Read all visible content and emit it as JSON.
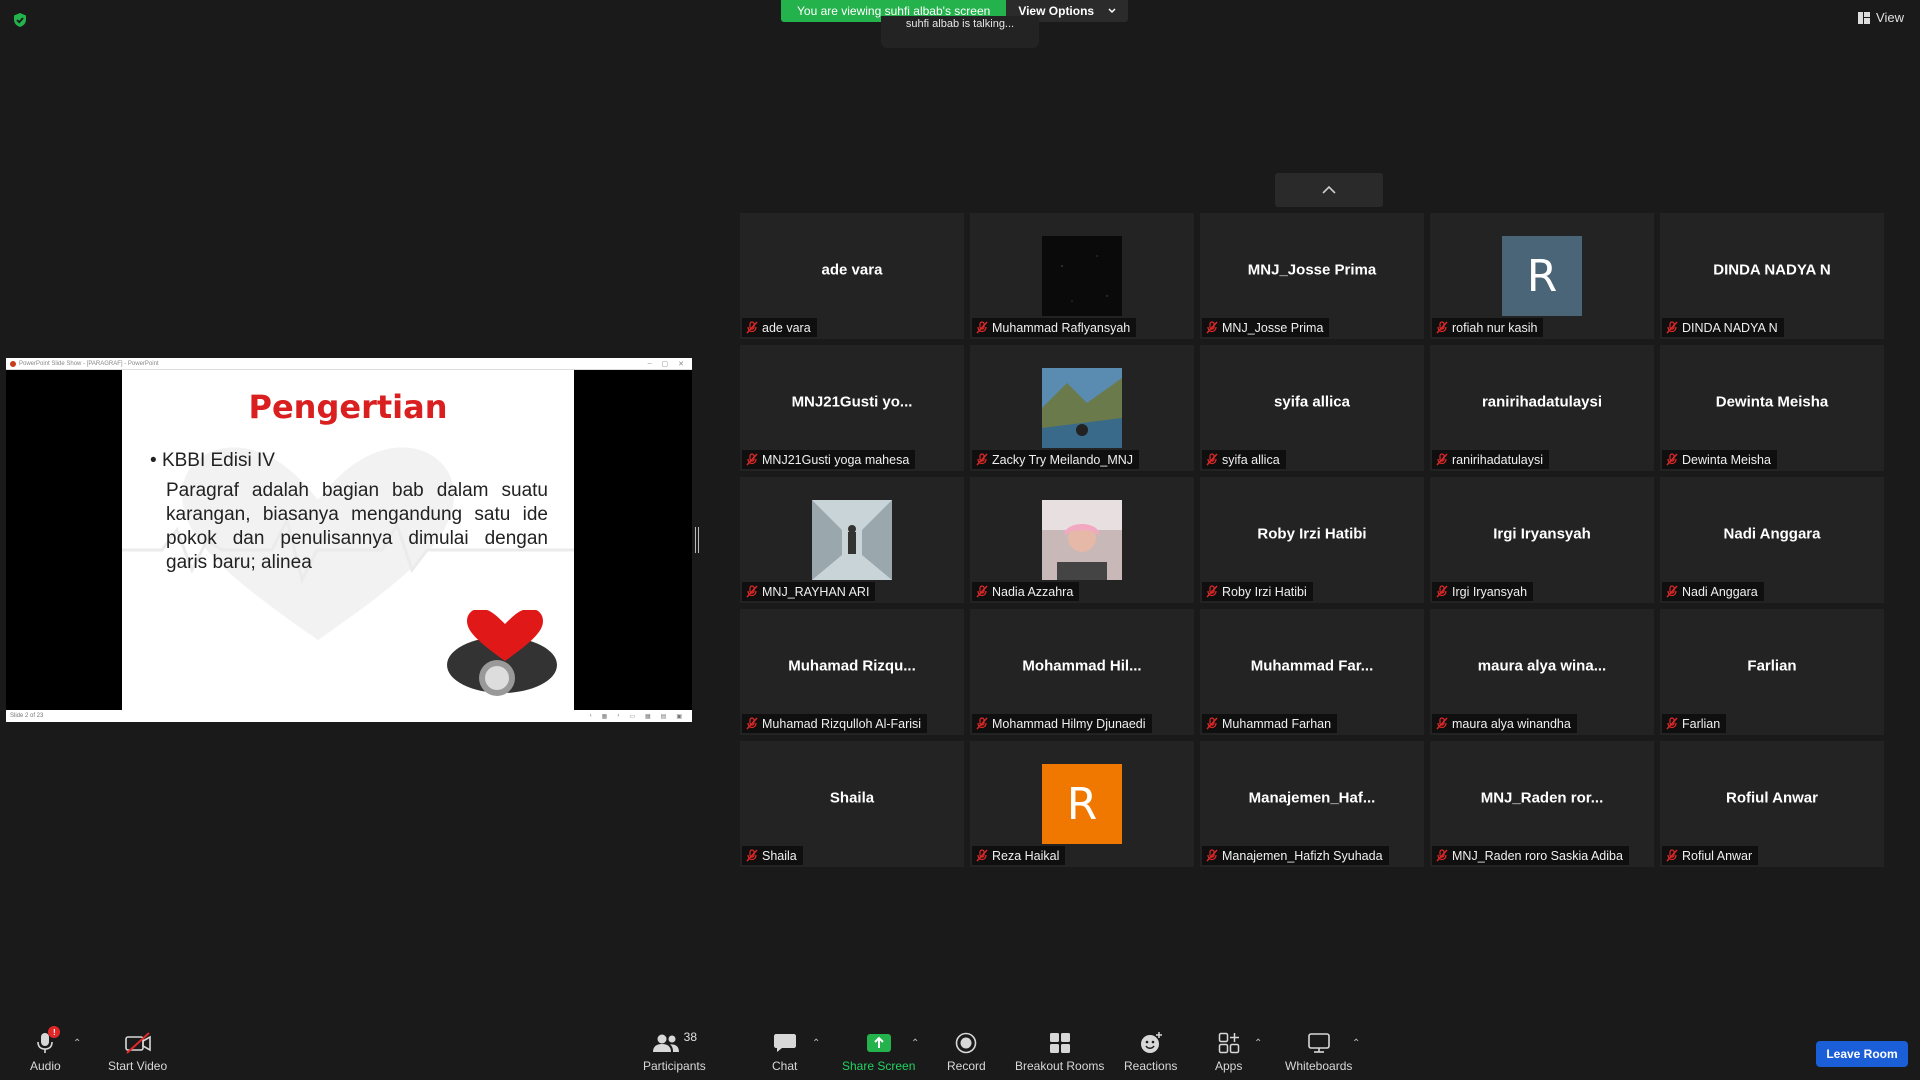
{
  "banner": {
    "viewing_text": "You are viewing suhfi albab's screen",
    "view_options_label": "View Options",
    "talking_text": "suhfi albab is talking..."
  },
  "top_right": {
    "view_label": "View"
  },
  "colors": {
    "banner_green": "#23b24b",
    "background": "#1a1a1a",
    "tile_background": "#232323",
    "leave_button": "#1a5ed8",
    "slide_title_red": "#d91f1f",
    "mute_red": "#e02828",
    "share_green": "#23d160"
  },
  "shared_screen": {
    "window_title": "PowerPoint Slide Show - [PARAGRAF] - PowerPoint",
    "slide_title": "Pengertian",
    "bullet": "KBBI Edisi IV",
    "paragraph": "Paragraf adalah bagian bab dalam suatu karangan, biasanya mengandung satu ide pokok dan penulisannya dimulai dengan garis baru; alinea",
    "status_left": "Slide 2 of 23"
  },
  "participants": [
    {
      "display": "ade vara",
      "label": "ade vara",
      "type": "name"
    },
    {
      "display": "",
      "label": "Muhammad Raflyansyah",
      "type": "image",
      "image": "dark"
    },
    {
      "display": "MNJ_Josse Prima",
      "label": "MNJ_Josse Prima",
      "type": "name"
    },
    {
      "display": "R",
      "label": "rofiah nur kasih",
      "type": "avatar",
      "color": "#4a6577"
    },
    {
      "display": "DINDA NADYA N",
      "label": "DINDA NADYA N",
      "type": "name"
    },
    {
      "display": "MNJ21Gusti yo...",
      "label": "MNJ21Gusti yoga mahesa",
      "type": "name"
    },
    {
      "display": "",
      "label": "Zacky Try Meilando_MNJ",
      "type": "image",
      "image": "landscape"
    },
    {
      "display": "syifa allica",
      "label": "syifa allica",
      "type": "name"
    },
    {
      "display": "ranirihadatulaysi",
      "label": "ranirihadatulaysi",
      "type": "name"
    },
    {
      "display": "Dewinta Meisha",
      "label": "Dewinta Meisha",
      "type": "name"
    },
    {
      "display": "",
      "label": "MNJ_RAYHAN ARI",
      "type": "image",
      "image": "corridor"
    },
    {
      "display": "",
      "label": "Nadia Azzahra",
      "type": "image",
      "image": "portrait"
    },
    {
      "display": "Roby Irzi Hatibi",
      "label": "Roby Irzi Hatibi",
      "type": "name"
    },
    {
      "display": "Irgi Iryansyah",
      "label": "Irgi Iryansyah",
      "type": "name"
    },
    {
      "display": "Nadi Anggara",
      "label": "Nadi Anggara",
      "type": "name"
    },
    {
      "display": "Muhamad Rizqu...",
      "label": "Muhamad Rizqulloh Al-Farisi",
      "type": "name"
    },
    {
      "display": "Mohammad Hil...",
      "label": "Mohammad Hilmy Djunaedi",
      "type": "name"
    },
    {
      "display": "Muhammad Far...",
      "label": "Muhammad Farhan",
      "type": "name"
    },
    {
      "display": "maura alya wina...",
      "label": "maura alya winandha",
      "type": "name"
    },
    {
      "display": "Farlian",
      "label": "Farlian",
      "type": "name"
    },
    {
      "display": "Shaila",
      "label": "Shaila",
      "type": "name"
    },
    {
      "display": "R",
      "label": "Reza Haikal",
      "type": "avatar",
      "color": "#f07800"
    },
    {
      "display": "Manajemen_Haf...",
      "label": "Manajemen_Hafizh Syuhada",
      "type": "name"
    },
    {
      "display": "MNJ_Raden ror...",
      "label": "MNJ_Raden roro Saskia Adiba",
      "type": "name"
    },
    {
      "display": "Rofiul Anwar",
      "label": "Rofiul Anwar",
      "type": "name"
    }
  ],
  "toolbar": {
    "audio_label": "Audio",
    "audio_badge": "!",
    "video_label": "Start Video",
    "participants_label": "Participants",
    "participants_count": "38",
    "chat_label": "Chat",
    "share_label": "Share Screen",
    "record_label": "Record",
    "breakout_label": "Breakout Rooms",
    "reactions_label": "Reactions",
    "apps_label": "Apps",
    "whiteboards_label": "Whiteboards",
    "leave_label": "Leave Room"
  },
  "icons": {
    "shield": "shield-icon",
    "audio": "microphone-icon",
    "video": "video-off-icon",
    "participants": "people-icon",
    "chat": "chat-bubble-icon",
    "share": "share-arrow-icon",
    "record": "record-icon",
    "breakout": "grid-icon",
    "reactions": "smiley-icon",
    "apps": "apps-icon",
    "whiteboards": "whiteboard-icon",
    "mute": "mic-muted-icon"
  }
}
